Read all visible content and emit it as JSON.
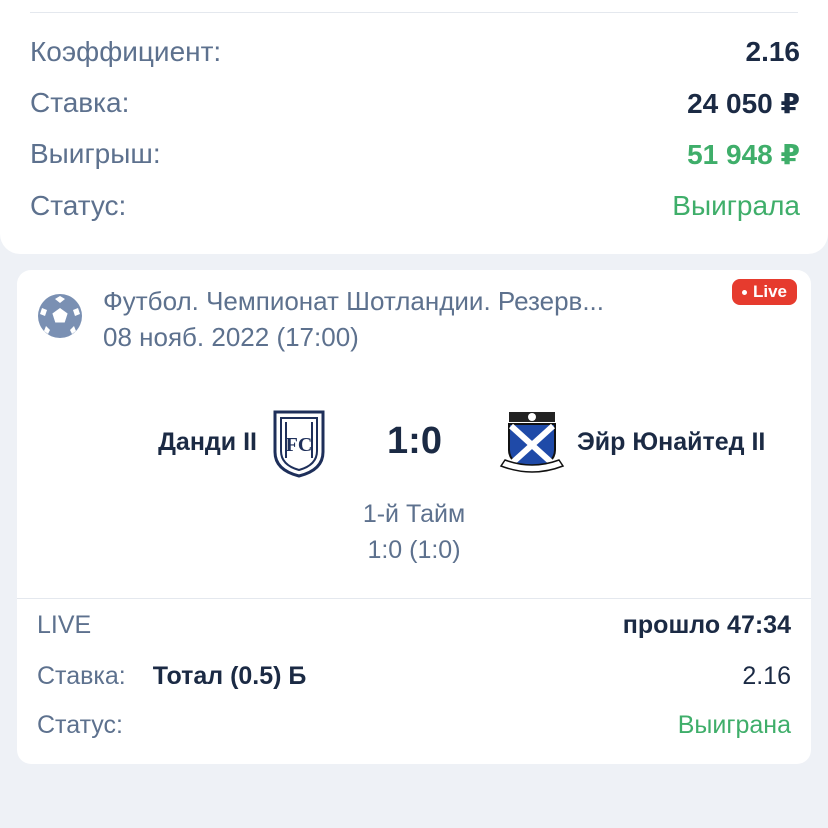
{
  "summary": {
    "coefficient_label": "Коэффициент:",
    "coefficient_value": "2.16",
    "stake_label": "Ставка:",
    "stake_value": "24 050 ₽",
    "win_label": "Выигрыш:",
    "win_value": "51 948 ₽",
    "status_label": "Статус:",
    "status_value": "Выиграла"
  },
  "event": {
    "sport_icon": "soccer-ball-icon",
    "league": "Футбол. Чемпионат Шотландии. Резерв...",
    "date": "08 нояб. 2022 (17:00)",
    "live_badge": "Live",
    "home_team": "Данди II",
    "home_crest_icon": "dundee-crest-icon",
    "score": "1:0",
    "away_team": "Эйр Юнайтед II",
    "away_crest_icon": "ayr-united-crest-icon",
    "period": "1-й Тайм",
    "period_score": "1:0 (1:0)"
  },
  "bet": {
    "type_label": "LIVE",
    "elapsed": "прошло 47:34",
    "stake_label": "Ставка:",
    "selection": "Тотал (0.5) Б",
    "odds": "2.16",
    "status_label": "Статус:",
    "status_value": "Выиграна"
  },
  "colors": {
    "win_green": "#3fae6a",
    "live_red": "#e63b2e",
    "label_gray": "#5d718e",
    "text_dark": "#1b2a44"
  }
}
